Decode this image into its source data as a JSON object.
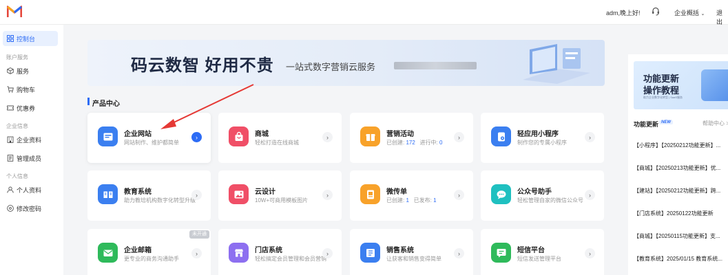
{
  "topbar": {
    "greeting": "adm,晚上好!",
    "overview": "企业概括",
    "logout": "退出"
  },
  "sidebar": {
    "dashboard": "控制台",
    "sections": [
      {
        "title": "账户服务",
        "items": [
          "服务",
          "购物车",
          "优惠券"
        ]
      },
      {
        "title": "企业信息",
        "items": [
          "企业资料",
          "管理成员"
        ]
      },
      {
        "title": "个人信息",
        "items": [
          "个人资料",
          "修改密码"
        ]
      }
    ]
  },
  "banner": {
    "headline": "码云数智  好用不贵",
    "subline": "一站式数字营销云服务"
  },
  "product_center": {
    "title": "产品中心",
    "cards": [
      {
        "name": "企业网站",
        "desc": "网站制作、维护都简单"
      },
      {
        "name": "商城",
        "desc": "轻松打造在线商城"
      },
      {
        "name": "营销活动",
        "created_label": "已创建:",
        "created": "172",
        "running_label": "进行中:",
        "running": "0"
      },
      {
        "name": "轻应用小程序",
        "desc": "制作您的专属小程序"
      },
      {
        "name": "教育系统",
        "desc": "助力教培机构数字化转型升级"
      },
      {
        "name": "云设计",
        "desc": "10W+可商用模板图片"
      },
      {
        "name": "微传单",
        "created_label": "已创建:",
        "created": "1",
        "published_label": "已发布:",
        "published": "1"
      },
      {
        "name": "公众号助手",
        "desc": "轻松管理自家的微信公众号"
      },
      {
        "name": "企业邮箱",
        "desc": "更专业的商务沟通助手",
        "badge": "未开通"
      },
      {
        "name": "门店系统",
        "desc": "轻松搞定会员管理和会员营销"
      },
      {
        "name": "销售系统",
        "desc": "让获客和销售变得简单"
      },
      {
        "name": "短信平台",
        "desc": "短信发送管理平台"
      }
    ]
  },
  "right_panel": {
    "promo_title_1": "功能更新",
    "promo_title_2": "操作教程",
    "promo_small": "助力企业数字化转型 | SaaS服务",
    "updates_label": "功能更新",
    "new_badge": "NEW",
    "help_center": "帮助中心 >",
    "updates": [
      "【小程序】【20250212功能更新】...",
      "【商城】【20250213功能更新】优...",
      "【建站】【20250212功能更新】跨...",
      "【门店系统】20250122功能更新",
      "【商城】【20250115功能更新】支...",
      "【教育系统】2025/01/15 教育系统..."
    ]
  },
  "colors": {
    "accent": "#2d6cf5"
  }
}
